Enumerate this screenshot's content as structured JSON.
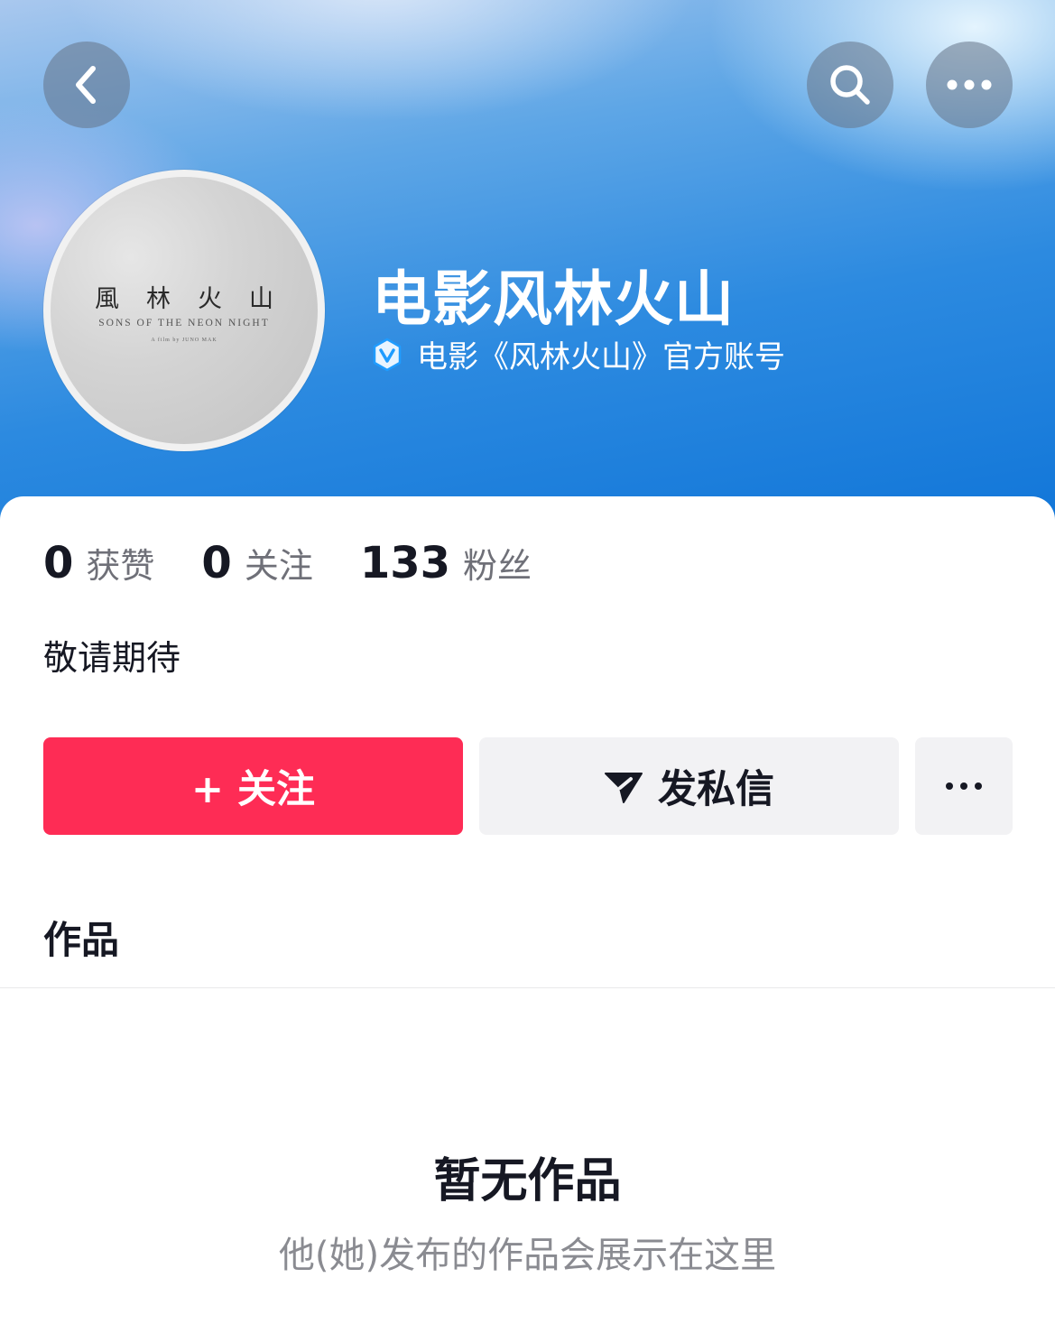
{
  "header": {
    "back_icon": "chevron-left-icon",
    "search_icon": "search-icon",
    "more_icon": "ellipsis-icon"
  },
  "profile": {
    "avatar": {
      "title_cn": "風林火山",
      "title_en": "SONS OF THE NEON NIGHT",
      "credit": "A film by JUNO MAK"
    },
    "name": "电影风林火山",
    "verified_icon": "verified-badge-icon",
    "verified_color": "#1f9cff",
    "verified_text": "电影《风林火山》官方账号"
  },
  "stats": [
    {
      "value": "0",
      "label": "获赞"
    },
    {
      "value": "0",
      "label": "关注"
    },
    {
      "value": "133",
      "label": "粉丝"
    }
  ],
  "bio": "敬请期待",
  "actions": {
    "follow_label": "+ 关注",
    "follow_color": "#fe2c55",
    "message_label": "发私信",
    "message_icon": "send-icon",
    "more_icon": "ellipsis-icon"
  },
  "tabs": {
    "works_label": "作品"
  },
  "empty_state": {
    "title": "暂无作品",
    "subtitle": "他(她)发布的作品会展示在这里"
  }
}
